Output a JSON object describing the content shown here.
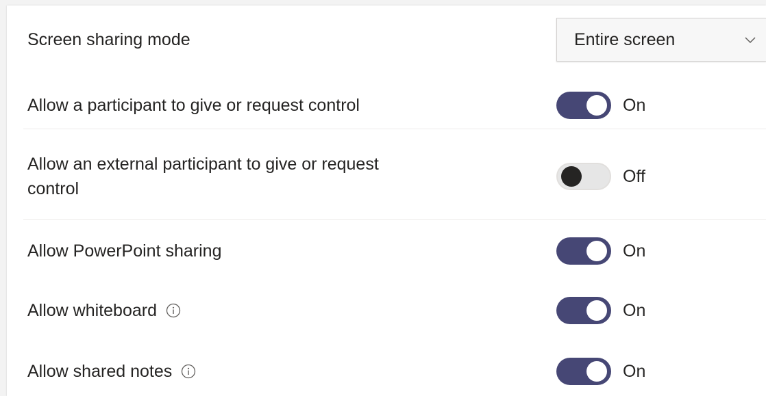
{
  "settings": {
    "screen_sharing_mode": {
      "label": "Screen sharing mode",
      "value": "Entire screen"
    },
    "give_request_control": {
      "label": "Allow a participant to give or request control",
      "state": "On"
    },
    "external_give_request_control": {
      "label_line1": "Allow an external participant to give or request",
      "label_line2": "control",
      "state": "Off"
    },
    "powerpoint_sharing": {
      "label": "Allow PowerPoint sharing",
      "state": "On"
    },
    "whiteboard": {
      "label": "Allow whiteboard",
      "state": "On"
    },
    "shared_notes": {
      "label": "Allow shared notes",
      "state": "On"
    }
  },
  "icons": {
    "info": "info-icon",
    "chevron": "chevron-down-icon"
  },
  "colors": {
    "toggle_on": "#464775",
    "toggle_off_knob": "#252423",
    "text": "#252423"
  }
}
